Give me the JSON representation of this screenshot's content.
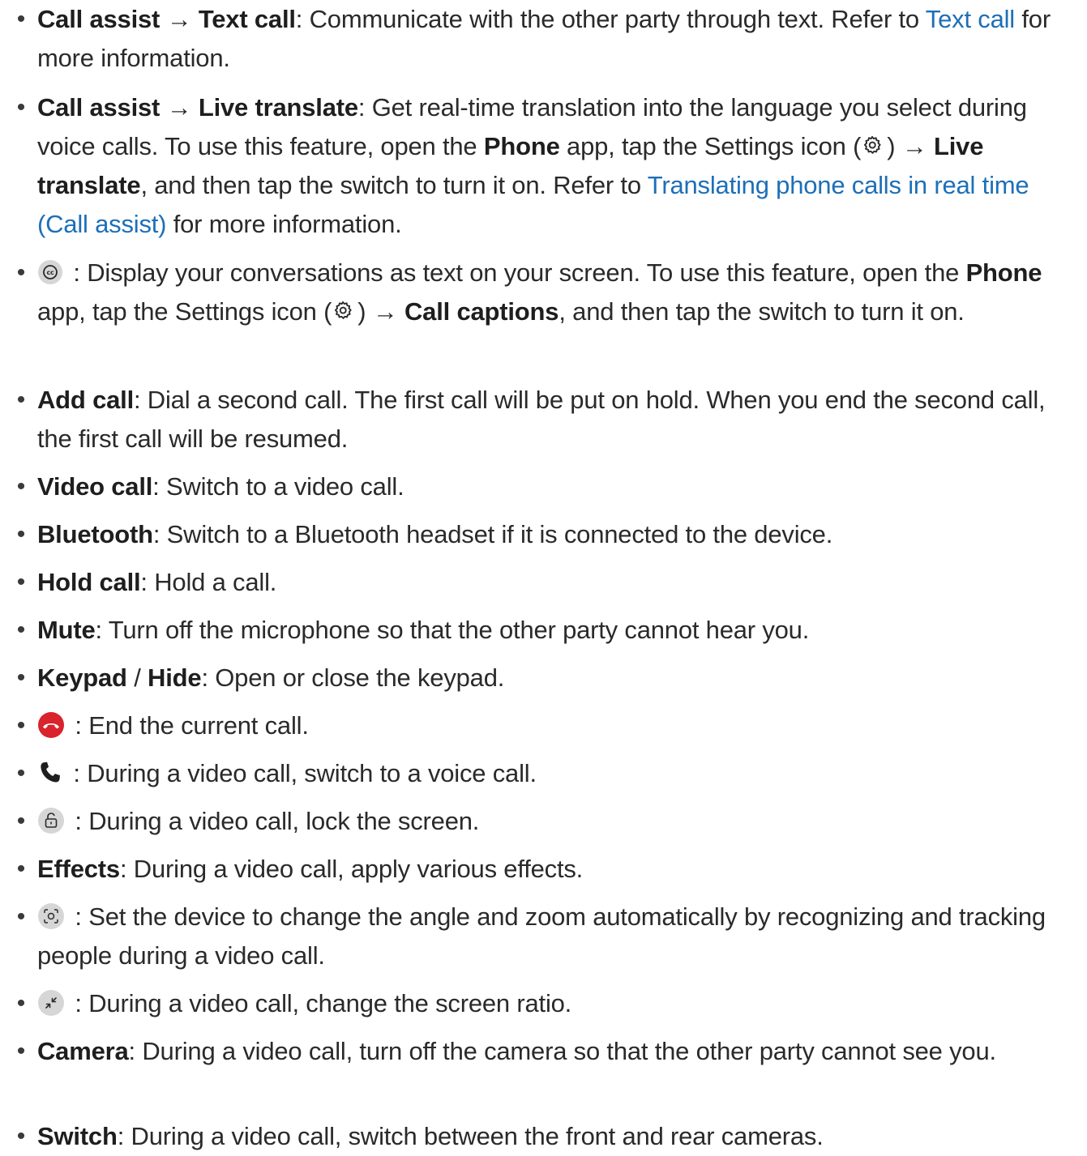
{
  "items": [
    {
      "label1": "Call assist",
      "arrow": "→",
      "label2": "Text call",
      "desc": ": Communicate with the other party through text. Refer to ",
      "link": "Text call",
      "tail": " for more information."
    },
    {
      "label1": "Call assist",
      "arrow": "→",
      "label2": "Live translate",
      "desc1": ": Get real-time translation into the language you select during voice calls. To use this feature, open the ",
      "bold1": "Phone",
      "desc2": " app, tap the Settings icon (",
      "desc3": ") ",
      "arrow2": "→",
      "bold2": "Live translate",
      "desc4": ", and then tap the switch to turn it on. Refer to ",
      "link": "Translating phone calls in real time (Call assist)",
      "tail": " for more information."
    },
    {
      "icon": "captions-icon",
      "desc1": " : Display your conversations as text on your screen. To use this feature, open the ",
      "bold1": "Phone",
      "desc2": " app, tap the Settings icon (",
      "desc3": ") ",
      "arrow": "→",
      "bold2": "Call captions",
      "desc4": ", and then tap the switch to turn it on."
    },
    {
      "label": "Add call",
      "desc": ": Dial a second call. The first call will be put on hold. When you end the second call, the first call will be resumed."
    },
    {
      "label": "Video call",
      "desc": ": Switch to a video call."
    },
    {
      "label": "Bluetooth",
      "desc": ": Switch to a Bluetooth headset if it is connected to the device."
    },
    {
      "label": "Hold call",
      "desc": ": Hold a call."
    },
    {
      "label": "Mute",
      "desc": ": Turn off the microphone so that the other party cannot hear you."
    },
    {
      "label1": "Keypad",
      "sep": " / ",
      "label2": "Hide",
      "desc": ": Open or close the keypad."
    },
    {
      "icon": "end-call-icon",
      "desc": " : End the current call."
    },
    {
      "icon": "voice-call-icon",
      "desc": " : During a video call, switch to a voice call."
    },
    {
      "icon": "lock-screen-icon",
      "desc": " : During a video call, lock the screen."
    },
    {
      "label": "Effects",
      "desc": ": During a video call, apply various effects."
    },
    {
      "icon": "auto-framing-icon",
      "desc": " : Set the device to change the angle and zoom automatically by recognizing and tracking people during a video call."
    },
    {
      "icon": "screen-ratio-icon",
      "desc": " : During a video call, change the screen ratio."
    },
    {
      "label": "Camera",
      "desc": ": During a video call, turn off the camera so that the other party cannot see you."
    },
    {
      "label": "Switch",
      "desc": ": During a video call, switch between the front and rear cameras."
    }
  ],
  "colors": {
    "text": "#2a2a2a",
    "link": "#1d6fb8",
    "end_call_red": "#d9232d",
    "icon_gray": "#d9d9d9"
  }
}
